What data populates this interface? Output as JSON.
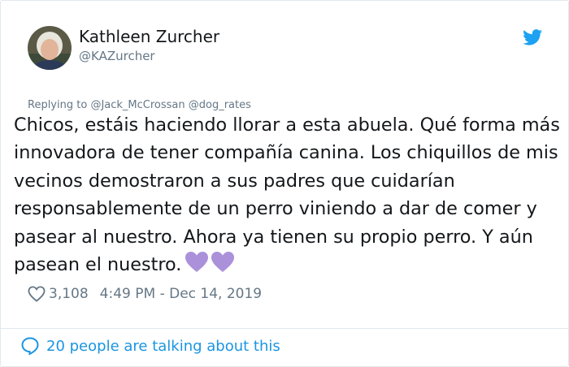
{
  "user": {
    "display_name": "Kathleen Zurcher",
    "handle": "@KAZurcher"
  },
  "reply": {
    "prefix": "Replying to ",
    "mentions": "@Jack_McCrossan @dog_rates"
  },
  "tweet": {
    "text": "Chicos, estáis haciendo llorar a esta abuela. Qué forma más innovadora de tener compañía canina. Los chiqui­llos de mis vecinos demostraron a sus padres que cui­darían responsablemente de un perro viniendo a dar de comer y pasear al nuestro. Ahora ya tienen su pro­pio perro. Y aún pasean el nuestro.",
    "emoji": "purple-hearts-icon"
  },
  "meta": {
    "likes": "3,108",
    "timestamp": "4:49 PM - Dec 14, 2019"
  },
  "footer": {
    "talking": "20 people are talking about this"
  },
  "colors": {
    "link": "#1b95e0",
    "muted": "#657786",
    "text": "#14171a",
    "border": "#e1e8ed",
    "heart_purple": "#ab91d9"
  }
}
